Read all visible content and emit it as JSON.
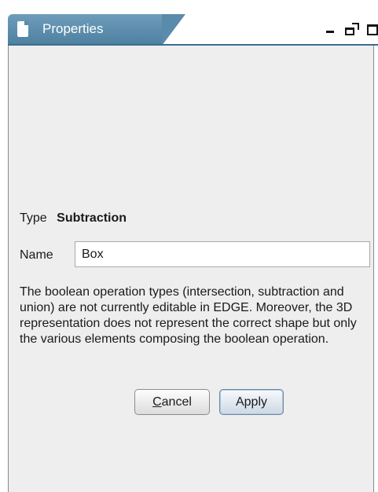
{
  "tab": {
    "title": "Properties",
    "icon": "document-icon"
  },
  "window_controls": {
    "minimize_icon": "minimize-icon",
    "float_icon": "float-window-icon",
    "maximize_icon": "maximize-icon"
  },
  "colors": {
    "tab_accent": "#5a8bab",
    "panel_background": "#eeeeee"
  },
  "form": {
    "type_label": "Type",
    "type_value": "Subtraction",
    "name_label": "Name",
    "name_value": "Box",
    "description": "The boolean operation types (intersection, subtraction and union) are not currently editable in EDGE. Moreover, the 3D representation does not represent the correct shape but only the various elements composing the boolean operation."
  },
  "buttons": {
    "cancel_mnemonic": "C",
    "cancel_rest": "ancel",
    "apply_label": "Apply"
  }
}
